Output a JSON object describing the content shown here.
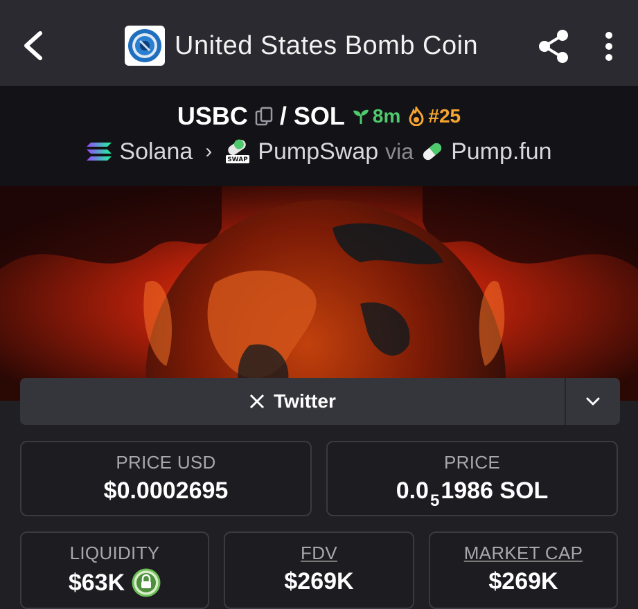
{
  "header": {
    "title": "United States Bomb Coin",
    "back_icon": "chevron-left-icon",
    "share_icon": "share-icon",
    "more_icon": "more-vertical-icon"
  },
  "pair": {
    "base": "USBC",
    "separator": "/",
    "quote": "SOL",
    "age": "8m",
    "rank": "#25",
    "age_color": "#4ec96b",
    "rank_color": "#f7a531"
  },
  "route": {
    "chain": "Solana",
    "dex": "PumpSwap",
    "via": "via",
    "launchpad": "Pump.fun"
  },
  "social": {
    "twitter_label": "Twitter"
  },
  "stats": {
    "price_usd_label": "PRICE USD",
    "price_usd_value": "$0.0002695",
    "price_label": "PRICE",
    "price_prefix": "0.0",
    "price_zeros": "5",
    "price_suffix": "1986 SOL",
    "liquidity_label": "LIQUIDITY",
    "liquidity_value": "$63K",
    "fdv_label": "FDV",
    "fdv_value": "$269K",
    "mcap_label": "MARKET CAP",
    "mcap_value": "$269K"
  }
}
